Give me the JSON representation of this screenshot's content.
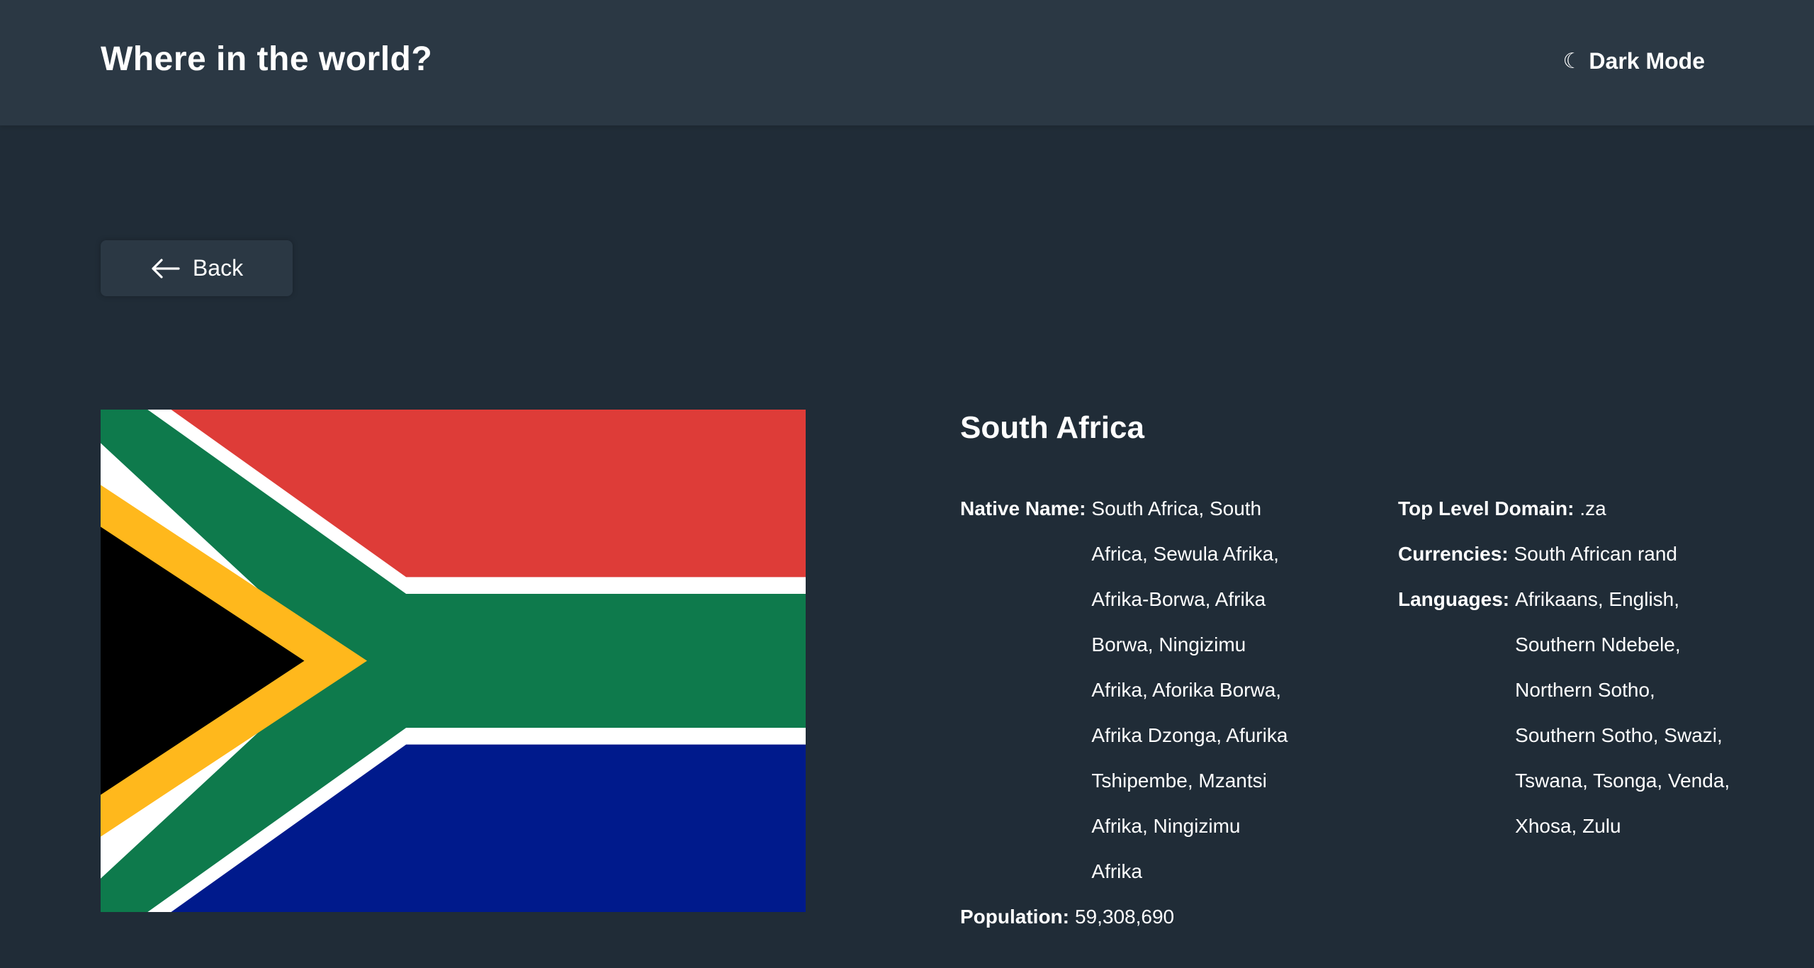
{
  "header": {
    "title": "Where in the world?",
    "mode_icon": "moon-icon",
    "mode_glyph": "☾",
    "mode_label": "Dark Mode"
  },
  "back": {
    "label": "Back",
    "icon": "arrow-left-icon"
  },
  "country": {
    "name": "South Africa",
    "flag_alt": "South Africa flag",
    "native_name_label": "Native Name:",
    "native_name": "South Africa, South Africa, Sewula Afrika, Afrika-Borwa, Afrika Borwa, Ningizimu Afrika, Aforika Borwa, Afrika Dzonga, Afurika Tshipembe, Mzantsi Afrika, Ningizimu Afrika",
    "population_label": "Population:",
    "population": "59,308,690",
    "tld_label": "Top Level Domain:",
    "tld": ".za",
    "currencies_label": "Currencies:",
    "currencies": "South African rand",
    "languages_label": "Languages:",
    "languages": "Afrikaans, English, Southern Ndebele, Northern Sotho, Southern Sotho, Swazi, Tswana, Tsonga, Venda, Xhosa, Zulu"
  },
  "colors": {
    "background": "#202c37",
    "surface": "#2b3844",
    "flag_red": "#de3c38",
    "flag_green": "#0e7a4c",
    "flag_blue": "#001a8c",
    "flag_gold": "#ffb81c",
    "flag_black": "#000000",
    "flag_white": "#ffffff"
  }
}
